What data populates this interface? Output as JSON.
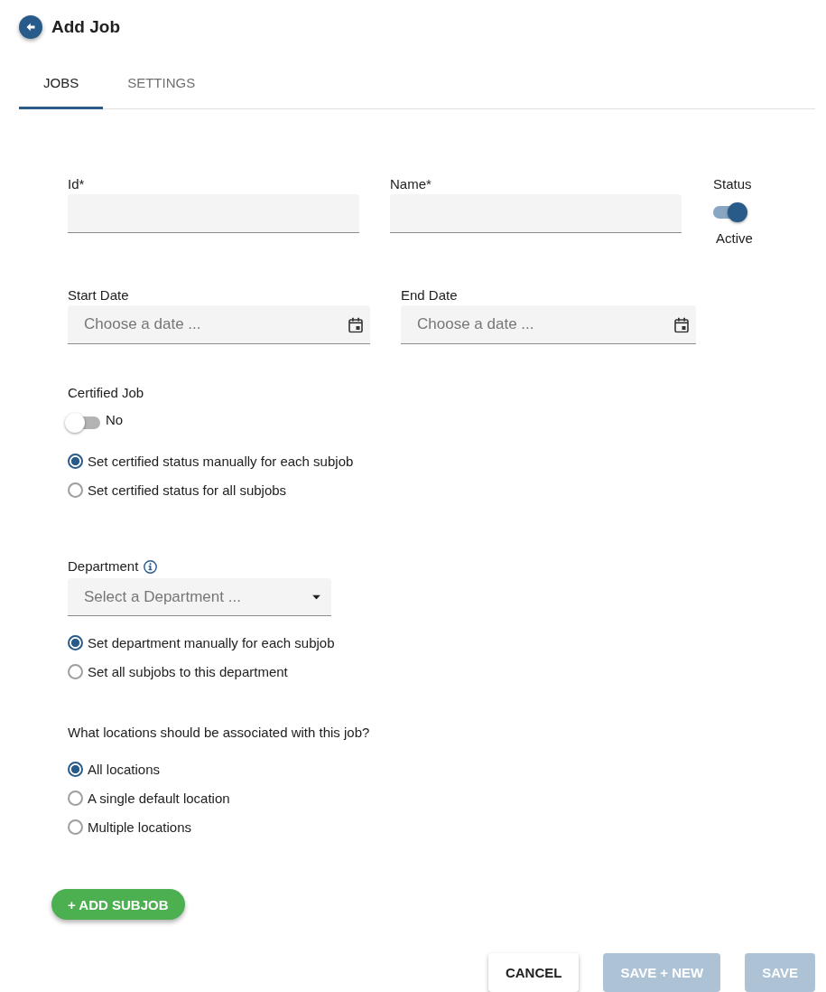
{
  "header": {
    "title": "Add Job"
  },
  "tabs": [
    {
      "label": "JOBS",
      "selected": true
    },
    {
      "label": "SETTINGS",
      "selected": false
    }
  ],
  "form": {
    "id_field": {
      "label": "Id*"
    },
    "name_field": {
      "label": "Name*"
    },
    "status": {
      "label": "Status",
      "on": true,
      "state_label": "Active"
    },
    "start_date": {
      "label": "Start Date",
      "placeholder": "Choose a date ..."
    },
    "end_date": {
      "label": "End Date",
      "placeholder": "Choose a date ..."
    },
    "certified_job": {
      "label": "Certified Job",
      "on": false,
      "state_label": "No",
      "options": [
        {
          "label": "Set certified status manually for each subjob",
          "selected": true
        },
        {
          "label": "Set certified status for all subjobs",
          "selected": false
        }
      ]
    },
    "department": {
      "label": "Department",
      "placeholder": "Select a Department ...",
      "options": [
        {
          "label": "Set department manually for each subjob",
          "selected": true
        },
        {
          "label": "Set all subjobs to this department",
          "selected": false
        }
      ]
    },
    "locations": {
      "question": "What locations should be associated with this job?",
      "options": [
        {
          "label": "All locations",
          "selected": true
        },
        {
          "label": "A single default location",
          "selected": false
        },
        {
          "label": "Multiple locations",
          "selected": false
        }
      ]
    }
  },
  "add_subjob_button": {
    "label": "+ ADD SUBJOB"
  },
  "footer_buttons": [
    {
      "label": "CANCEL",
      "disabled": false
    },
    {
      "label": "SAVE + NEW",
      "disabled": true
    },
    {
      "label": "SAVE",
      "disabled": true
    }
  ]
}
